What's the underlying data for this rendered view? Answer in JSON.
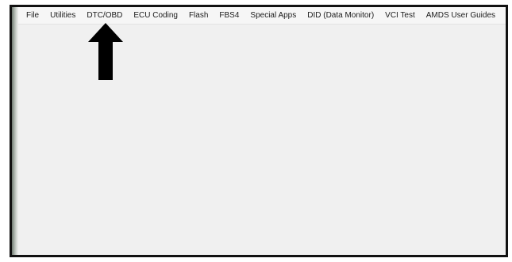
{
  "menu": {
    "items": [
      {
        "label": "File"
      },
      {
        "label": "Utilities"
      },
      {
        "label": "DTC/OBD"
      },
      {
        "label": "ECU Coding"
      },
      {
        "label": "Flash"
      },
      {
        "label": "FBS4"
      },
      {
        "label": "Special Apps"
      },
      {
        "label": "DID (Data Monitor)"
      },
      {
        "label": "VCI Test"
      },
      {
        "label": "AMDS User Guides"
      }
    ]
  },
  "annotation": {
    "icon": "arrow-up-icon",
    "points_to": "DTC/OBD",
    "color": "#000000"
  },
  "colors": {
    "window_background": "#f0f0f0",
    "frame_border": "#111111"
  }
}
